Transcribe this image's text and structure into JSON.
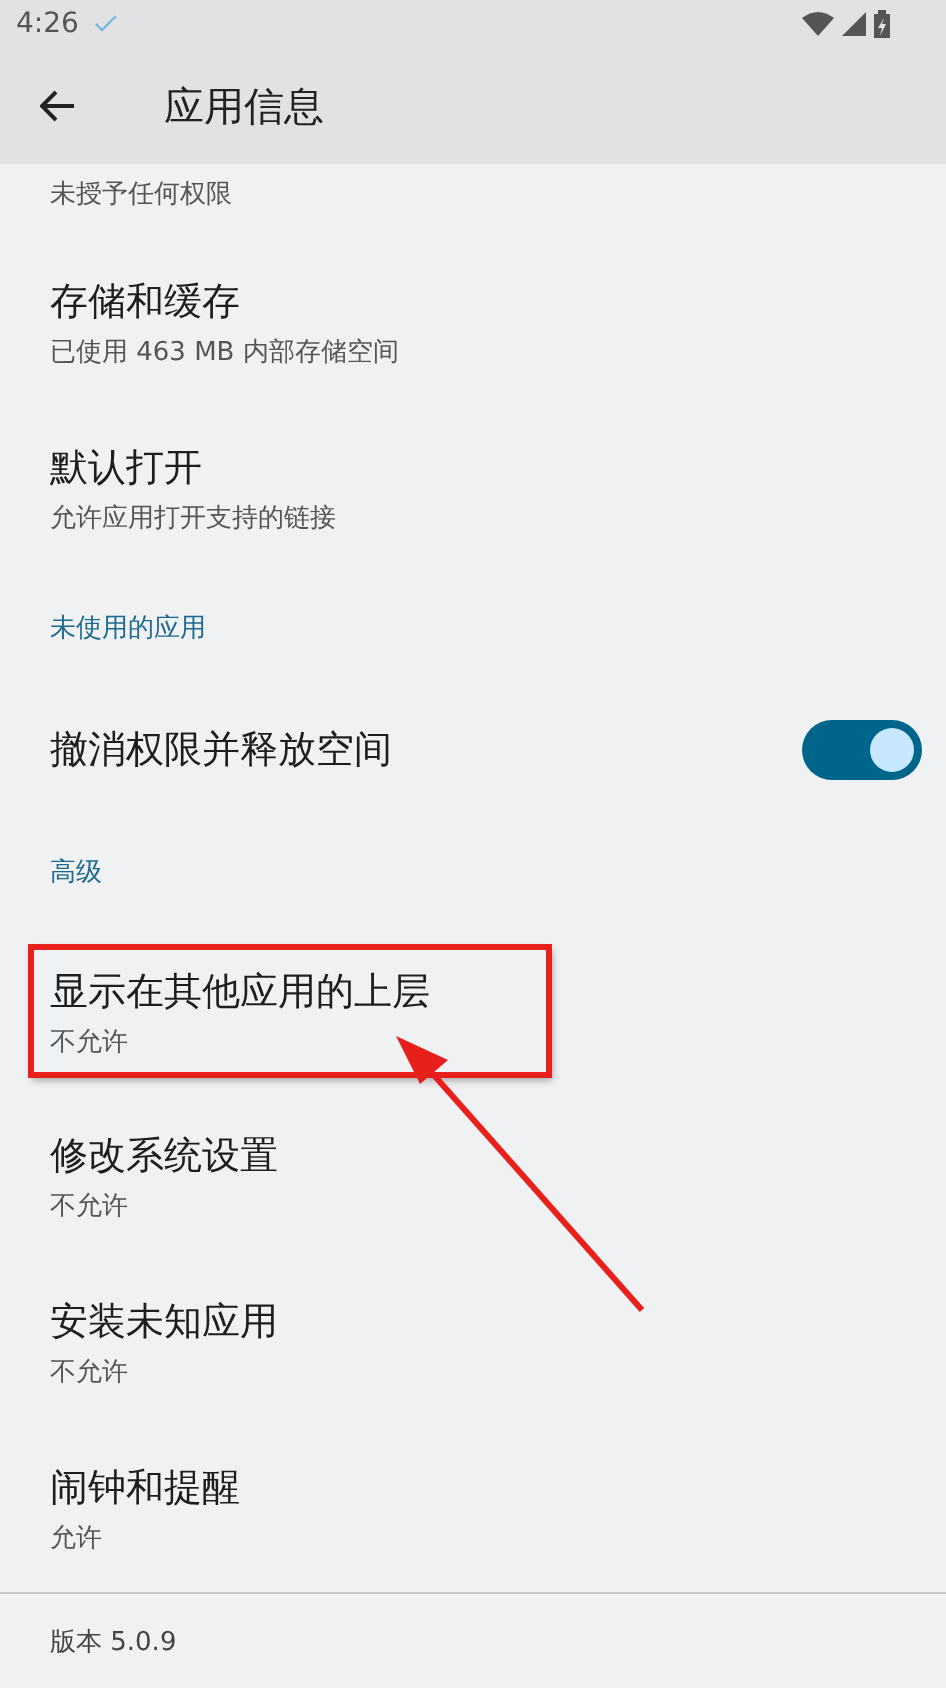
{
  "status_bar": {
    "time": "4:26"
  },
  "app_bar": {
    "title": "应用信息"
  },
  "items": [
    {
      "kind": "cut",
      "subtitle": "未授予任何权限"
    },
    {
      "kind": "item",
      "title": "存储和缓存",
      "subtitle": "已使用 463 MB 内部存储空间",
      "highlighted": false
    },
    {
      "kind": "item",
      "title": "默认打开",
      "subtitle": "允许应用打开支持的链接",
      "highlighted": false
    },
    {
      "kind": "header",
      "title": "未使用的应用"
    },
    {
      "kind": "switch",
      "title": "撤消权限并释放空间",
      "on": true
    },
    {
      "kind": "header",
      "title": "高级"
    },
    {
      "kind": "item",
      "title": "显示在其他应用的上层",
      "subtitle": "不允许",
      "highlighted": true
    },
    {
      "kind": "item",
      "title": "修改系统设置",
      "subtitle": "不允许",
      "highlighted": false
    },
    {
      "kind": "item",
      "title": "安装未知应用",
      "subtitle": "不允许",
      "highlighted": false
    },
    {
      "kind": "item",
      "title": "闹钟和提醒",
      "subtitle": "允许",
      "highlighted": false
    }
  ],
  "footer": {
    "version": "版本 5.0.9"
  }
}
